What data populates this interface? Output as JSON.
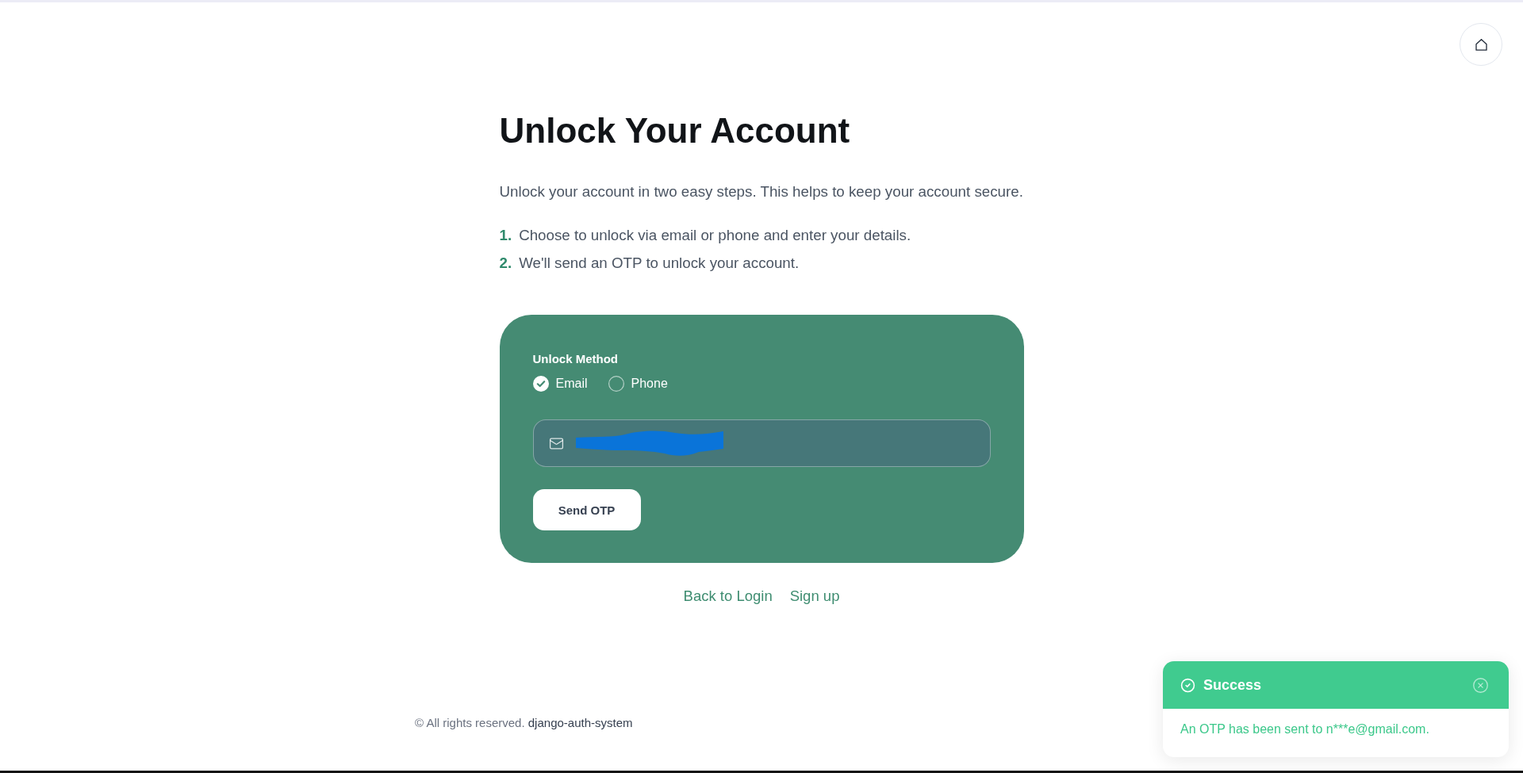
{
  "header": {
    "title": "Unlock Your Account",
    "intro": "Unlock your account in two easy steps. This helps to keep your account secure.",
    "steps": [
      {
        "number": "1.",
        "text": "Choose to unlock via email or phone and enter your details."
      },
      {
        "number": "2.",
        "text": "We'll send an OTP to unlock your account."
      }
    ]
  },
  "unlock_form": {
    "method_label": "Unlock Method",
    "methods": [
      {
        "label": "Email",
        "selected": true
      },
      {
        "label": "Phone",
        "selected": false
      }
    ],
    "email_field": {
      "kind": "email",
      "redacted": true
    },
    "submit_button": "Send OTP"
  },
  "links": [
    "Back to Login",
    "Sign up"
  ],
  "footer": {
    "text": "© All rights reserved. **django-auth-system**"
  },
  "toast": {
    "kind": "success",
    "title": "Success",
    "message": "An OTP has been sent to n***e@gmail.com."
  }
}
